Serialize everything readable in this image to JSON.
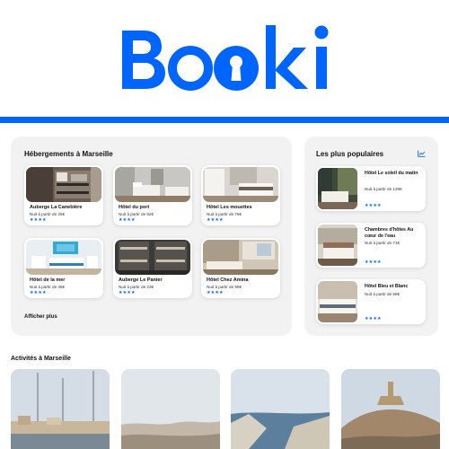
{
  "brand": {
    "logo_text": "Booki",
    "color": "#0065FC"
  },
  "stays": {
    "title": "Hébergements à Marseille",
    "show_more_label": "Afficher plus",
    "items": [
      {
        "name": "Auberge La Canebière",
        "price": "Nuit à partir de 25€",
        "rating": 4,
        "stars": "★★★★"
      },
      {
        "name": "Hôtel du port",
        "price": "Nuit à partir de 52€",
        "rating": 4,
        "stars": "★★★★"
      },
      {
        "name": "Hôtel Les mouettes",
        "price": "Nuit à partir de 76€",
        "rating": 4,
        "stars": "★★★★"
      },
      {
        "name": "Hôtel de la mer",
        "price": "Nuit à partir de 46€",
        "rating": 4,
        "stars": "★★★★"
      },
      {
        "name": "Auberge Le Panier",
        "price": "Nuit à partir de 23€",
        "rating": 4,
        "stars": "★★★★"
      },
      {
        "name": "Hôtel Chez Amina",
        "price": "Nuit à partir de 96€",
        "rating": 4,
        "stars": "★★★★"
      }
    ]
  },
  "popular": {
    "title": "Les plus populaires",
    "icon": "chart-trend-icon",
    "items": [
      {
        "name": "Hôtel Le soleil du matin",
        "price": "Nuit à partir de 128€",
        "rating": 4,
        "stars": "★★★★"
      },
      {
        "name": "Chambres d'hôtes Au cœur de l'eau",
        "price": "Nuit à partir de 71€",
        "rating": 4,
        "stars": "★★★★"
      },
      {
        "name": "Hôtel Bleu et Blanc",
        "price": "Nuit à partir de 68€",
        "rating": 4,
        "stars": "★★★★"
      }
    ]
  },
  "activities": {
    "title": "Activités à Marseille"
  }
}
